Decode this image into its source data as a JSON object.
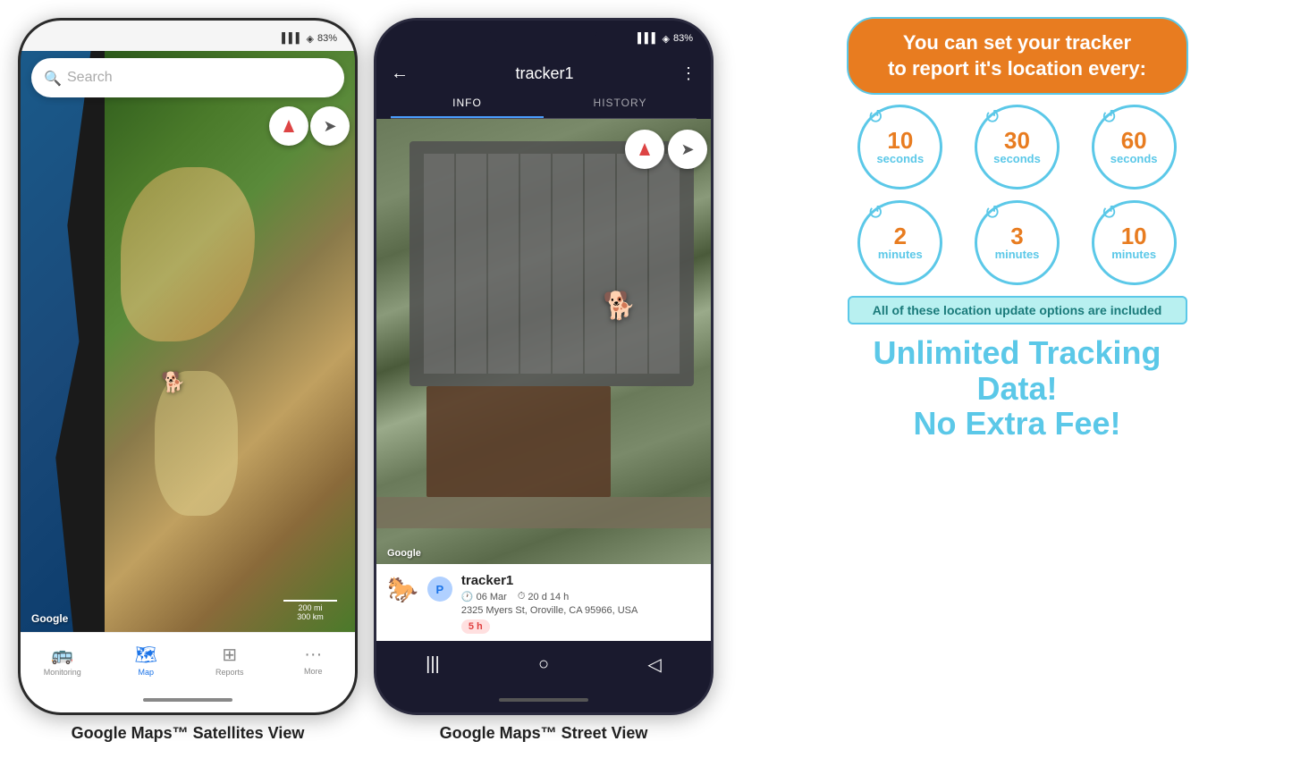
{
  "phone1": {
    "status": {
      "time": "",
      "signal": "▌▌▌",
      "battery": "83%"
    },
    "search_placeholder": "Search",
    "nav": [
      {
        "icon": "🚌",
        "label": "Monitoring",
        "active": false
      },
      {
        "icon": "🗺",
        "label": "Map",
        "active": true
      },
      {
        "icon": "⊞",
        "label": "Reports",
        "active": false
      },
      {
        "icon": "···",
        "label": "More",
        "active": false
      }
    ],
    "google_label": "Google",
    "scale_200mi": "200 mi",
    "scale_300km": "300 km",
    "caption": "Google Maps™ Satellites View"
  },
  "phone2": {
    "status": {
      "signal": "▌▌▌",
      "battery": "83%"
    },
    "header": {
      "title": "tracker1",
      "tab_info": "INFO",
      "tab_history": "HISTORY"
    },
    "info_card": {
      "name": "tracker1",
      "parking_label": "P",
      "date": "06 Mar",
      "duration": "20 d 14 h",
      "address": "2325 Myers St, Oroville, CA 95966, USA",
      "time_ago": "5 h"
    },
    "google_label": "Google",
    "caption": "Google Maps™ Street View"
  },
  "promo": {
    "line1": "You can set your tracker",
    "line2": "to report it's location every:",
    "included": "All of these location update options are included",
    "unlimited1": "Unlimited Tracking Data!",
    "unlimited2": "No Extra Fee!"
  },
  "intervals": [
    {
      "number": "10",
      "unit": "seconds"
    },
    {
      "number": "30",
      "unit": "seconds"
    },
    {
      "number": "60",
      "unit": "seconds"
    },
    {
      "number": "2",
      "unit": "minutes"
    },
    {
      "number": "3",
      "unit": "minutes"
    },
    {
      "number": "10",
      "unit": "minutes"
    }
  ]
}
